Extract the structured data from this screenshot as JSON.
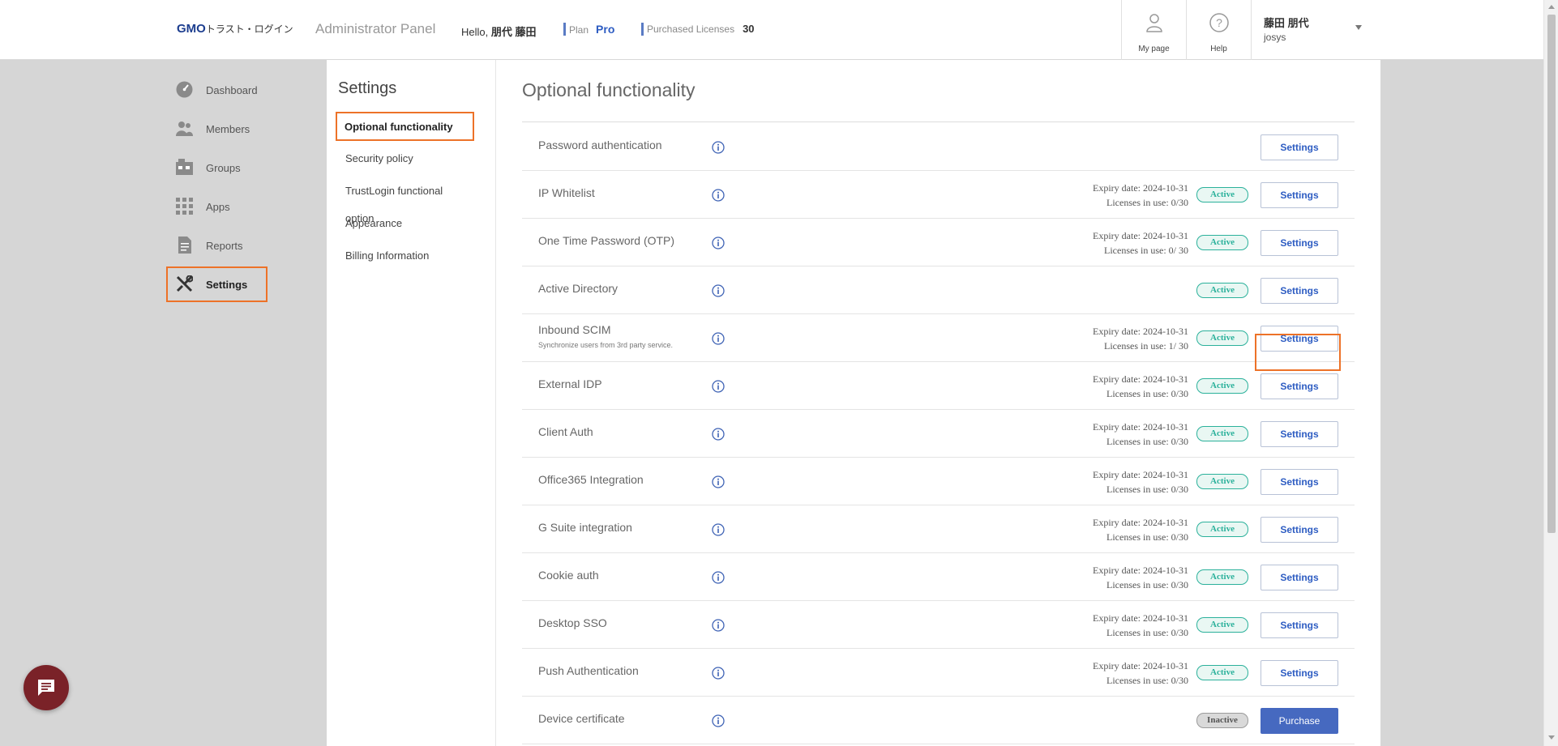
{
  "header": {
    "logo_brand": "GMO",
    "logo_product": "トラスト・ログイン",
    "app_title": "Administrator Panel",
    "greeting_prefix": "Hello,",
    "user_display_name": "朋代 藤田",
    "plan_label": "Plan",
    "plan_value": "Pro",
    "licenses_label": "Purchased Licenses",
    "licenses_value": "30",
    "mypage_label": "My page",
    "help_label": "Help",
    "user_name": "藤田 朋代",
    "user_org": "josys"
  },
  "nav": {
    "items": [
      {
        "label": "Dashboard",
        "icon": "dashboard-icon"
      },
      {
        "label": "Members",
        "icon": "members-icon"
      },
      {
        "label": "Groups",
        "icon": "groups-icon"
      },
      {
        "label": "Apps",
        "icon": "apps-icon"
      },
      {
        "label": "Reports",
        "icon": "reports-icon"
      },
      {
        "label": "Settings",
        "icon": "settings-icon",
        "active": true
      }
    ]
  },
  "submenu": {
    "title": "Settings",
    "items": [
      {
        "label": "Optional functionality",
        "active": true
      },
      {
        "label": "Security policy"
      },
      {
        "label": "TrustLogin functional option"
      },
      {
        "label": "Appearance"
      },
      {
        "label": "Billing Information"
      }
    ]
  },
  "main": {
    "title": "Optional functionality",
    "settings_label": "Settings",
    "purchase_label": "Purchase",
    "rows": [
      {
        "name": "Password authentication",
        "desc": "",
        "expiry": "",
        "licenses": "",
        "status": ""
      },
      {
        "name": "IP Whitelist",
        "desc": "",
        "expiry": "Expiry date: 2024-10-31",
        "licenses": "Licenses in use: 0/30",
        "status": "Active"
      },
      {
        "name": "One Time Password (OTP)",
        "desc": "",
        "expiry": "Expiry date: 2024-10-31",
        "licenses": "Licenses in use: 0/ 30",
        "status": "Active"
      },
      {
        "name": "Active Directory",
        "desc": "",
        "expiry": "",
        "licenses": "",
        "status": "Active"
      },
      {
        "name": "Inbound SCIM",
        "desc": "Synchronize users from 3rd party service.",
        "expiry": "Expiry date: 2024-10-31",
        "licenses": "Licenses in use: 1/ 30",
        "status": "Active",
        "highlighted": true
      },
      {
        "name": "External IDP",
        "desc": "",
        "expiry": "Expiry date: 2024-10-31",
        "licenses": "Licenses in use: 0/30",
        "status": "Active"
      },
      {
        "name": "Client Auth",
        "desc": "",
        "expiry": "Expiry date: 2024-10-31",
        "licenses": "Licenses in use: 0/30",
        "status": "Active"
      },
      {
        "name": "Office365 Integration",
        "desc": "",
        "expiry": "Expiry date: 2024-10-31",
        "licenses": "Licenses in use: 0/30",
        "status": "Active"
      },
      {
        "name": "G Suite integration",
        "desc": "",
        "expiry": "Expiry date: 2024-10-31",
        "licenses": "Licenses in use: 0/30",
        "status": "Active"
      },
      {
        "name": "Cookie auth",
        "desc": "",
        "expiry": "Expiry date: 2024-10-31",
        "licenses": "Licenses in use: 0/30",
        "status": "Active"
      },
      {
        "name": "Desktop SSO",
        "desc": "",
        "expiry": "Expiry date: 2024-10-31",
        "licenses": "Licenses in use: 0/30",
        "status": "Active"
      },
      {
        "name": "Push Authentication",
        "desc": "",
        "expiry": "Expiry date: 2024-10-31",
        "licenses": "Licenses in use: 0/30",
        "status": "Active"
      },
      {
        "name": "Device certificate",
        "desc": "",
        "expiry": "",
        "licenses": "",
        "status": "Inactive",
        "action": "purchase"
      }
    ]
  },
  "colors": {
    "accent_orange": "#ed7228",
    "brand_blue": "#2d5cc2",
    "active_green": "#2bb19b",
    "chat_bubble": "#7a2228"
  }
}
